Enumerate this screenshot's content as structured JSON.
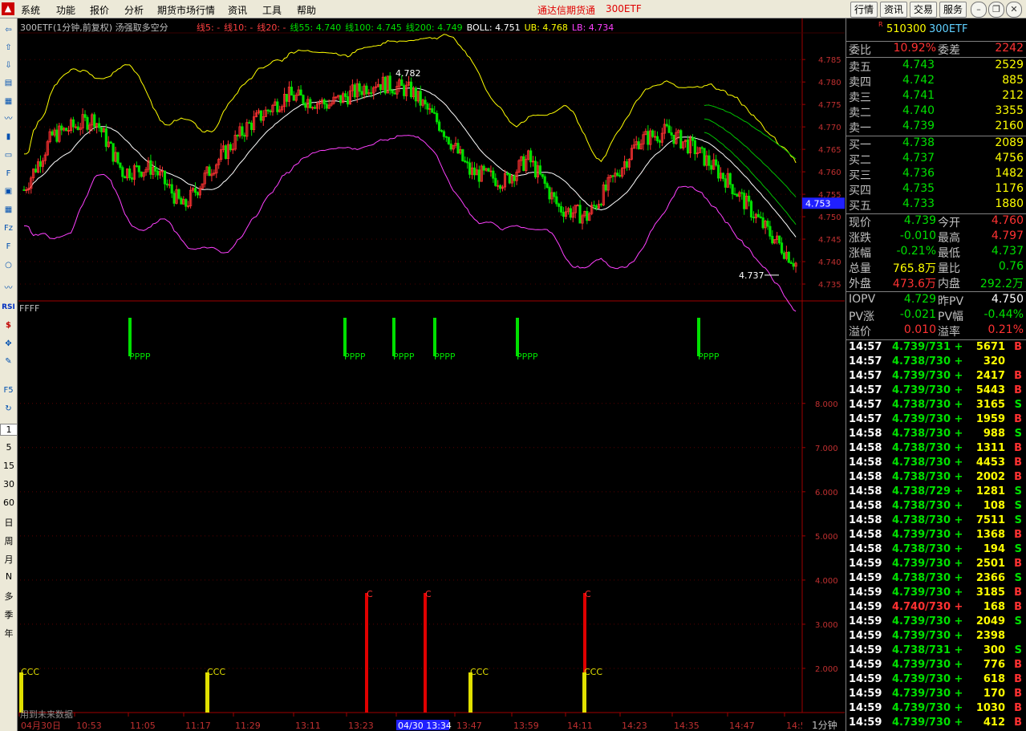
{
  "menu": {
    "items": [
      "系统",
      "功能",
      "报价",
      "分析",
      "期货市场行情",
      "资讯",
      "工具",
      "帮助"
    ],
    "window_title": "通达信期货通",
    "symbol_title": "300ETF",
    "right_tabs": [
      "行情",
      "资讯",
      "交易",
      "服务"
    ]
  },
  "toolbar": {
    "icons": [
      "back-arrow-icon",
      "up-arrow-icon",
      "down-arrow-icon",
      "quote-icon",
      "table-icon",
      "trend-icon",
      "kline-icon",
      "list-icon",
      "f10-icon",
      "news-icon",
      "calendar-icon",
      "f2-icon",
      "f6-icon",
      "circle-icon",
      "wave-icon",
      "rsi-icon",
      "dollar-icon",
      "move-icon",
      "pencil-icon",
      "f5-icon",
      "refresh-icon"
    ],
    "periods": [
      "1",
      "5",
      "15",
      "30",
      "60",
      "日",
      "周",
      "月",
      "N",
      "多",
      "季",
      "年"
    ]
  },
  "chart": {
    "header_title": "300ETF(1分钟,前复权) 汤强取多空分",
    "ma_items": [
      {
        "text": "线5: -",
        "color": "#ff4040"
      },
      {
        "text": "线10: -",
        "color": "#ff4040"
      },
      {
        "text": "线20: -",
        "color": "#ff4040"
      },
      {
        "text": "线55: 4.740",
        "color": "#00e000"
      },
      {
        "text": "线100: 4.745",
        "color": "#00e000"
      },
      {
        "text": "线200: 4.749",
        "color": "#00e000"
      },
      {
        "text": "BOLL: 4.751",
        "color": "#ffffff"
      },
      {
        "text": "UB: 4.768",
        "color": "#ffff00"
      },
      {
        "text": "LB: 4.734",
        "color": "#ff40ff"
      }
    ],
    "price_axis": [
      "4.785",
      "4.780",
      "4.775",
      "4.770",
      "4.765",
      "4.760",
      "4.755",
      "4.750",
      "4.745",
      "4.740",
      "4.735"
    ],
    "current_price_tag": "4.753",
    "high_label": "4.782",
    "low_label": "4.737",
    "sub_title": "FFFF",
    "sub_axis": [
      "8.000",
      "7.000",
      "6.000",
      "5.000",
      "4.000",
      "3.000",
      "2.000"
    ],
    "signal_p_label": "PPPP",
    "signal_c_label": "C",
    "signal_ccc_label": "CCC",
    "future_note": "用到未来数据",
    "time_axis": [
      "04月30日",
      "10:53",
      "11:05",
      "11:17",
      "11:29",
      "13:11",
      "13:23",
      "04/30 13:34",
      "13:47",
      "13:59",
      "14:11",
      "14:23",
      "14:35",
      "14:47",
      "14:5"
    ],
    "period_label": "1分钟",
    "colors": {
      "up": "#ff3232",
      "down": "#00e000",
      "boll_mid": "#ffffff",
      "boll_up": "#ffff00",
      "boll_low": "#ff40ff",
      "grid": "#a00000"
    }
  },
  "quote": {
    "code": "510300",
    "name": "300ETF",
    "weibi_label": "委比",
    "weibi": "10.92%",
    "weicha_label": "委差",
    "weicha": "2242",
    "asks": [
      {
        "label": "卖五",
        "price": "4.743",
        "vol": "2529"
      },
      {
        "label": "卖四",
        "price": "4.742",
        "vol": "885"
      },
      {
        "label": "卖三",
        "price": "4.741",
        "vol": "212"
      },
      {
        "label": "卖二",
        "price": "4.740",
        "vol": "3355"
      },
      {
        "label": "卖一",
        "price": "4.739",
        "vol": "2160"
      }
    ],
    "bids": [
      {
        "label": "买一",
        "price": "4.738",
        "vol": "2089"
      },
      {
        "label": "买二",
        "price": "4.737",
        "vol": "4756"
      },
      {
        "label": "买三",
        "price": "4.736",
        "vol": "1482"
      },
      {
        "label": "买四",
        "price": "4.735",
        "vol": "1176"
      },
      {
        "label": "买五",
        "price": "4.733",
        "vol": "1880"
      }
    ],
    "stats": [
      {
        "l1": "现价",
        "v1": "4.739",
        "c1": "#00e000",
        "l2": "今开",
        "v2": "4.760",
        "c2": "#ff3232"
      },
      {
        "l1": "涨跌",
        "v1": "-0.010",
        "c1": "#00e000",
        "l2": "最高",
        "v2": "4.797",
        "c2": "#ff3232"
      },
      {
        "l1": "涨幅",
        "v1": "-0.21%",
        "c1": "#00e000",
        "l2": "最低",
        "v2": "4.737",
        "c2": "#00e000"
      },
      {
        "l1": "总量",
        "v1": "765.8万",
        "c1": "#ffff00",
        "l2": "量比",
        "v2": "0.76",
        "c2": "#00e000"
      },
      {
        "l1": "外盘",
        "v1": "473.6万",
        "c1": "#ff3232",
        "l2": "内盘",
        "v2": "292.2万",
        "c2": "#00e000"
      }
    ],
    "iopv": [
      {
        "l1": "IOPV",
        "v1": "4.729",
        "c1": "#00e000",
        "l2": "昨PV",
        "v2": "4.750",
        "c2": "#ffffff"
      },
      {
        "l1": "PV涨",
        "v1": "-0.021",
        "c1": "#00e000",
        "l2": "PV幅",
        "v2": "-0.44%",
        "c2": "#00e000"
      },
      {
        "l1": "溢价",
        "v1": "0.010",
        "c1": "#ff3232",
        "l2": "溢率",
        "v2": "0.21%",
        "c2": "#ff3232"
      }
    ],
    "ticks": [
      {
        "t": "14:57",
        "p": "4.739/731 +",
        "v": "5671",
        "s": "B"
      },
      {
        "t": "14:57",
        "p": "4.738/730 +",
        "v": "320",
        "s": ""
      },
      {
        "t": "14:57",
        "p": "4.739/730 +",
        "v": "2417",
        "s": "B"
      },
      {
        "t": "14:57",
        "p": "4.739/730 +",
        "v": "5443",
        "s": "B"
      },
      {
        "t": "14:57",
        "p": "4.738/730 +",
        "v": "3165",
        "s": "S"
      },
      {
        "t": "14:57",
        "p": "4.739/730 +",
        "v": "1959",
        "s": "B"
      },
      {
        "t": "14:58",
        "p": "4.738/730 +",
        "v": "988",
        "s": "S"
      },
      {
        "t": "14:58",
        "p": "4.738/730 +",
        "v": "1311",
        "s": "B"
      },
      {
        "t": "14:58",
        "p": "4.738/730 +",
        "v": "4453",
        "s": "B"
      },
      {
        "t": "14:58",
        "p": "4.738/730 +",
        "v": "2002",
        "s": "B"
      },
      {
        "t": "14:58",
        "p": "4.738/729 +",
        "v": "1281",
        "s": "S"
      },
      {
        "t": "14:58",
        "p": "4.738/730 +",
        "v": "108",
        "s": "S"
      },
      {
        "t": "14:58",
        "p": "4.738/730 +",
        "v": "7511",
        "s": "S"
      },
      {
        "t": "14:58",
        "p": "4.739/730 +",
        "v": "1368",
        "s": "B"
      },
      {
        "t": "14:58",
        "p": "4.738/730 +",
        "v": "194",
        "s": "S"
      },
      {
        "t": "14:59",
        "p": "4.739/730 +",
        "v": "2501",
        "s": "B"
      },
      {
        "t": "14:59",
        "p": "4.738/730 +",
        "v": "2366",
        "s": "S"
      },
      {
        "t": "14:59",
        "p": "4.739/730 +",
        "v": "3185",
        "s": "B"
      },
      {
        "t": "14:59",
        "p": "4.740/730 +",
        "v": "168",
        "s": "B"
      },
      {
        "t": "14:59",
        "p": "4.739/730 +",
        "v": "2049",
        "s": "S"
      },
      {
        "t": "14:59",
        "p": "4.739/730 +",
        "v": "2398",
        "s": ""
      },
      {
        "t": "14:59",
        "p": "4.738/731 +",
        "v": "300",
        "s": "S"
      },
      {
        "t": "14:59",
        "p": "4.739/730 +",
        "v": "776",
        "s": "B"
      },
      {
        "t": "14:59",
        "p": "4.739/730 +",
        "v": "618",
        "s": "B"
      },
      {
        "t": "14:59",
        "p": "4.739/730 +",
        "v": "170",
        "s": "B"
      },
      {
        "t": "14:59",
        "p": "4.739/730 +",
        "v": "1030",
        "s": "B"
      },
      {
        "t": "14:59",
        "p": "4.739/730 +",
        "v": "412",
        "s": "B"
      }
    ]
  }
}
